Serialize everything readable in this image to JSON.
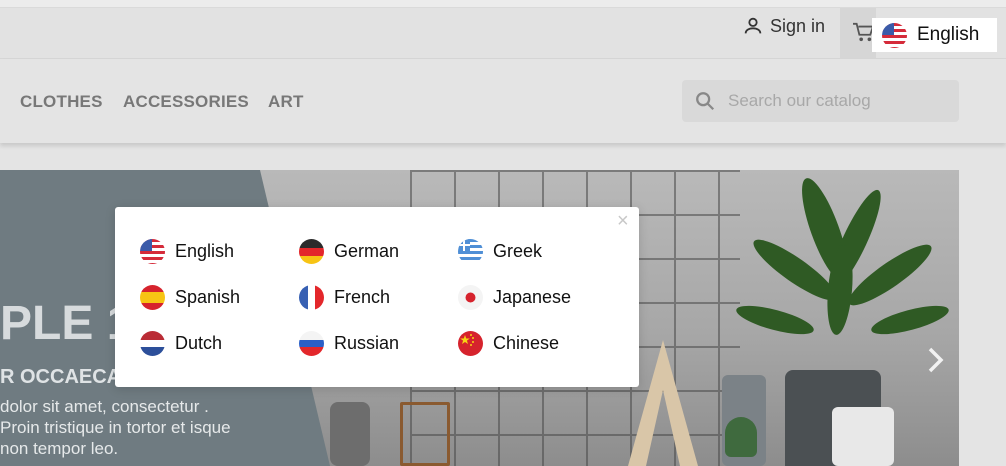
{
  "header": {
    "sign_in_label": "Sign in",
    "current_language": "English"
  },
  "nav": {
    "items": [
      "CLOTHES",
      "ACCESSORIES",
      "ART"
    ]
  },
  "search": {
    "placeholder": "Search our catalog"
  },
  "hero": {
    "title": "PLE 1",
    "subtitle": "R OCCAECA",
    "text": "dolor sit amet, consectetur . Proin tristique in tortor et isque non tempor leo."
  },
  "language_modal": {
    "close_symbol": "×",
    "languages": [
      {
        "label": "English",
        "flag": "us-flag-icon"
      },
      {
        "label": "German",
        "flag": "german-flag-icon"
      },
      {
        "label": "Greek",
        "flag": "greek-flag-icon"
      },
      {
        "label": "Spanish",
        "flag": "spanish-flag-icon"
      },
      {
        "label": "French",
        "flag": "french-flag-icon"
      },
      {
        "label": "Japanese",
        "flag": "japanese-flag-icon"
      },
      {
        "label": "Dutch",
        "flag": "dutch-flag-icon"
      },
      {
        "label": "Russian",
        "flag": "russian-flag-icon"
      },
      {
        "label": "Chinese",
        "flag": "chinese-flag-icon"
      }
    ]
  },
  "colors": {
    "background": "#e4e4e4",
    "nav_text": "#787878",
    "modal_bg": "#ffffff"
  }
}
